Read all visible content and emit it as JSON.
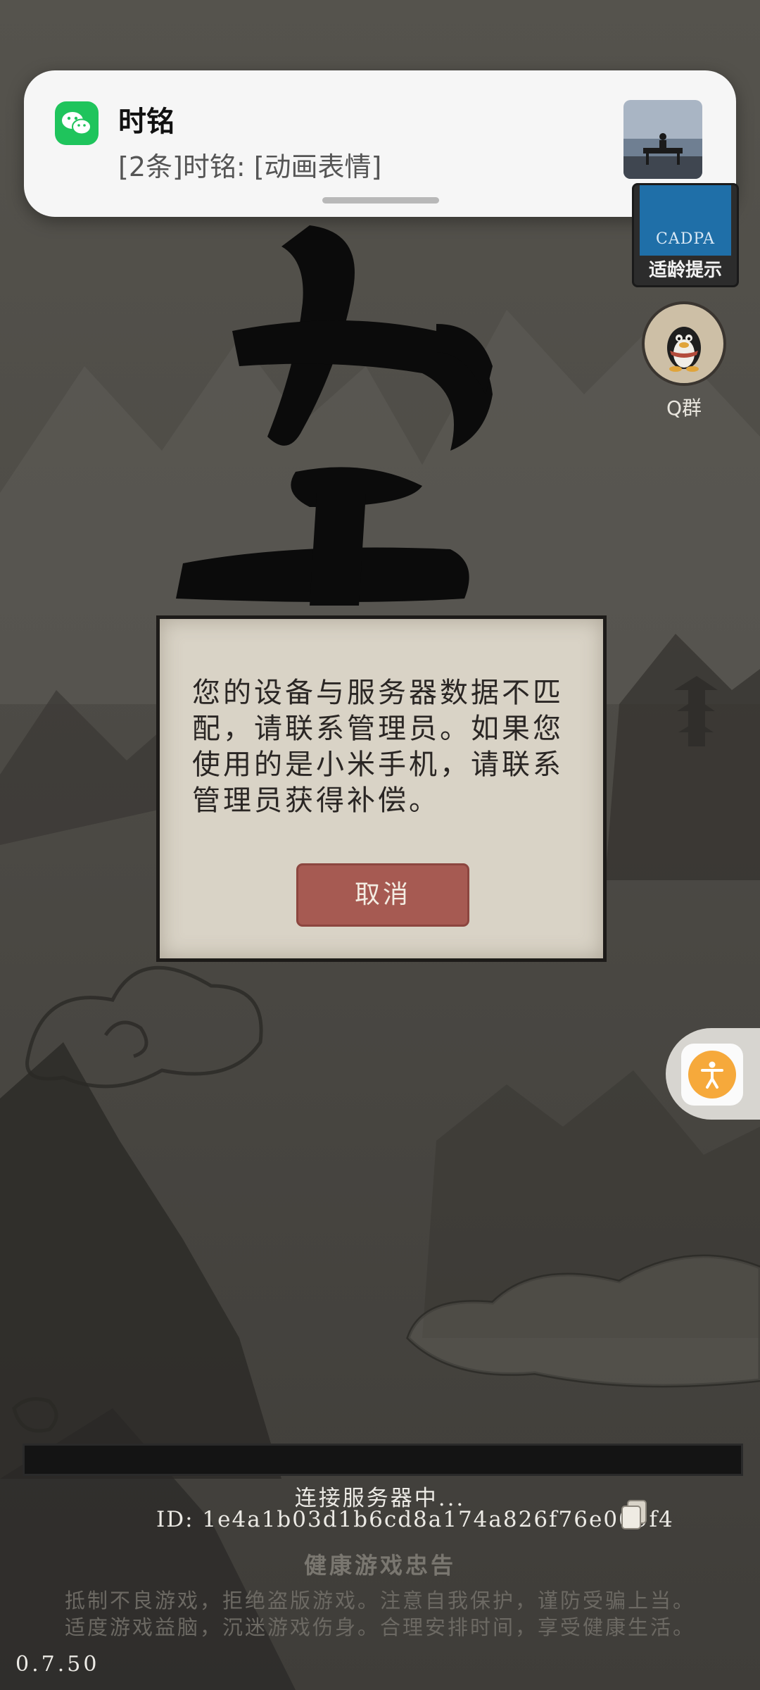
{
  "notification": {
    "app_icon": "wechat-icon",
    "sender": "时铭",
    "message": "[2条]时铭: [动画表情]"
  },
  "age_badge": {
    "code": "CADPA",
    "label": "适龄提示"
  },
  "qq_group": {
    "icon": "qq-penguin-icon",
    "label": "Q群"
  },
  "dialog": {
    "message": "您的设备与服务器数据不匹配，请联系管理员。如果您使用的是小米手机，请联系管理员获得补偿。",
    "cancel_label": "取消"
  },
  "accessibility": {
    "icon": "accessibility-person-icon",
    "color": "#f6a93b"
  },
  "status": {
    "connecting": "连接服务器中...",
    "id_prefix": "ID:",
    "id_value": "1e4a1b03d1b6cd8a174a826f76e009f4"
  },
  "health_notice": {
    "title": "健康游戏忠告",
    "line1": "抵制不良游戏，拒绝盗版游戏。注意自我保护，谨防受骗上当。",
    "line2": "适度游戏益脑，沉迷游戏伤身。合理安排时间，享受健康生活。"
  },
  "version": "0.7.50",
  "colors": {
    "dialog_bg": "#d9d3c6",
    "cancel_button": "#a65a52",
    "wechat_green": "#1fc45c"
  }
}
